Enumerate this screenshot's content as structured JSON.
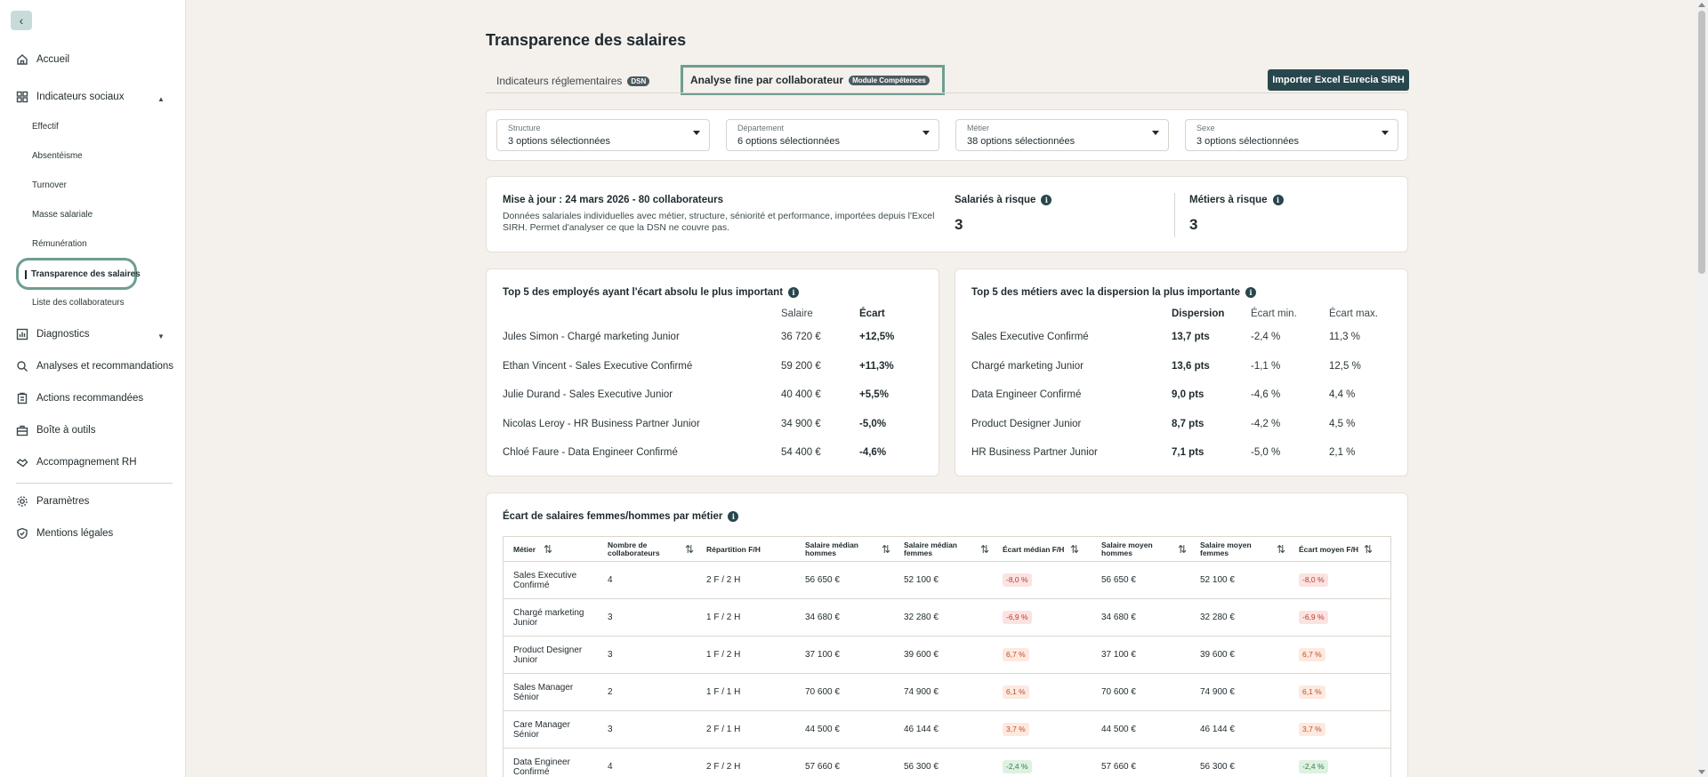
{
  "sidebar": {
    "back_icon": "‹",
    "items": {
      "accueil": "Accueil",
      "indicateurs": "Indicateurs sociaux",
      "diagnostics": "Diagnostics",
      "analyses": "Analyses et recommandations",
      "actions": "Actions recommandées",
      "boite": "Boîte à outils",
      "accompagnement": "Accompagnement RH",
      "parametres": "Paramètres",
      "mentions": "Mentions légales"
    },
    "sub_items": {
      "effectif": "Effectif",
      "absenteisme": "Absentéisme",
      "turnover": "Turnover",
      "masse": "Masse salariale",
      "remuneration": "Rémunération",
      "transparence": "Transparence des salaires",
      "liste": "Liste des collaborateurs"
    }
  },
  "page": {
    "title": "Transparence des salaires",
    "tab1_label": "Indicateurs réglementaires",
    "tab1_badge": "DSN",
    "tab2_label": "Analyse fine par collaborateur",
    "tab2_badge": "Module Compétences",
    "import_button": "Importer Excel Eurecia SIRH"
  },
  "filters": [
    {
      "label": "Structure",
      "value": "3 options sélectionnées"
    },
    {
      "label": "Département",
      "value": "6 options sélectionnées"
    },
    {
      "label": "Métier",
      "value": "38 options sélectionnées"
    },
    {
      "label": "Sexe",
      "value": "3 options sélectionnées"
    }
  ],
  "summary": {
    "title": "Mise à jour : 24 mars 2026 - 80 collaborateurs",
    "description": "Données salariales individuelles avec métier, structure, séniorité et performance, importées depuis l'Excel SIRH. Permet d'analyser ce que la DSN ne couvre pas.",
    "kpi1_label": "Salariés à risque",
    "kpi1_value": "3",
    "kpi2_label": "Métiers à risque",
    "kpi2_value": "3",
    "info_icon": "i"
  },
  "top_employees": {
    "title": "Top 5 des employés ayant l'écart absolu le plus important",
    "col_salary": "Salaire",
    "col_gap": "Écart",
    "rows": [
      {
        "name": "Jules Simon - Chargé marketing Junior",
        "salary": "36 720 €",
        "gap": "+12,5%"
      },
      {
        "name": "Ethan Vincent - Sales Executive Confirmé",
        "salary": "59 200 €",
        "gap": "+11,3%"
      },
      {
        "name": "Julie Durand - Sales Executive Junior",
        "salary": "40 400 €",
        "gap": "+5,5%"
      },
      {
        "name": "Nicolas Leroy - HR Business Partner Junior",
        "salary": "34 900 €",
        "gap": "-5,0%"
      },
      {
        "name": "Chloé Faure - Data Engineer Confirmé",
        "salary": "54 400 €",
        "gap": "-4,6%"
      }
    ]
  },
  "top_jobs": {
    "title": "Top 5 des métiers avec la dispersion la plus importante",
    "col_dispersion": "Dispersion",
    "col_min": "Écart min.",
    "col_max": "Écart max.",
    "rows": [
      {
        "job": "Sales Executive Confirmé",
        "dispersion": "13,7 pts",
        "min": "-2,4 %",
        "max": "11,3 %"
      },
      {
        "job": "Chargé marketing Junior",
        "dispersion": "13,6 pts",
        "min": "-1,1 %",
        "max": "12,5 %"
      },
      {
        "job": "Data Engineer Confirmé",
        "dispersion": "9,0 pts",
        "min": "-4,6 %",
        "max": "4,4 %"
      },
      {
        "job": "Product Designer Junior",
        "dispersion": "8,7 pts",
        "min": "-4,2 %",
        "max": "4,5 %"
      },
      {
        "job": "HR Business Partner Junior",
        "dispersion": "7,1 pts",
        "min": "-5,0 %",
        "max": "2,1 %"
      }
    ]
  },
  "gender_table": {
    "title": "Écart de salaires femmes/hommes par métier",
    "sort_icon": "⇅",
    "headers": [
      "Métier",
      "Nombre de collaborateurs",
      "Répartition F/H",
      "Salaire médian hommes",
      "Salaire médian femmes",
      "Écart médian F/H",
      "Salaire moyen hommes",
      "Salaire moyen femmes",
      "Écart moyen F/H"
    ],
    "rows": [
      {
        "job": "Sales Executive Confirmé",
        "count": "4",
        "split": "2 F / 2 H",
        "med_h": "56 650 €",
        "med_f": "52 100 €",
        "gap_med": "-8,0 %",
        "avg_h": "56 650 €",
        "avg_f": "52 100 €",
        "gap_avg": "-8,0 %",
        "tone": "neg"
      },
      {
        "job": "Chargé marketing Junior",
        "count": "3",
        "split": "1 F / 2 H",
        "med_h": "34 680 €",
        "med_f": "32 280 €",
        "gap_med": "-6,9 %",
        "avg_h": "34 680 €",
        "avg_f": "32 280 €",
        "gap_avg": "-6,9 %",
        "tone": "neg"
      },
      {
        "job": "Product Designer Junior",
        "count": "3",
        "split": "1 F / 2 H",
        "med_h": "37 100 €",
        "med_f": "39 600 €",
        "gap_med": "6,7 %",
        "avg_h": "37 100 €",
        "avg_f": "39 600 €",
        "gap_avg": "6,7 %",
        "tone": "warn"
      },
      {
        "job": "Sales Manager Sénior",
        "count": "2",
        "split": "1 F / 1 H",
        "med_h": "70 600 €",
        "med_f": "74 900 €",
        "gap_med": "6,1 %",
        "avg_h": "70 600 €",
        "avg_f": "74 900 €",
        "gap_avg": "6,1 %",
        "tone": "warn"
      },
      {
        "job": "Care Manager Sénior",
        "count": "3",
        "split": "2 F / 1 H",
        "med_h": "44 500 €",
        "med_f": "46 144 €",
        "gap_med": "3,7 %",
        "avg_h": "44 500 €",
        "avg_f": "46 144 €",
        "gap_avg": "3,7 %",
        "tone": "warn"
      },
      {
        "job": "Data Engineer Confirmé",
        "count": "4",
        "split": "2 F / 2 H",
        "med_h": "57 660 €",
        "med_f": "56 300 €",
        "gap_med": "-2,4 %",
        "avg_h": "57 660 €",
        "avg_f": "56 300 €",
        "gap_avg": "-2,4 %",
        "tone": "pos"
      }
    ]
  }
}
